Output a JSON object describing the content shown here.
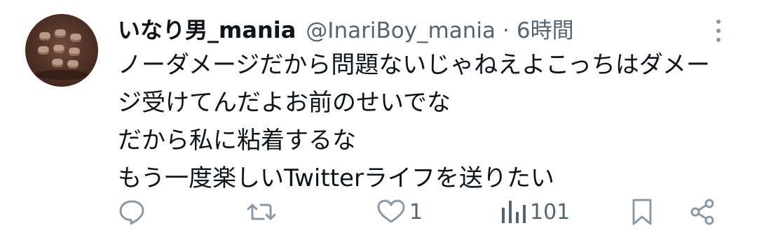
{
  "author": {
    "display_name": "いなり男_mania",
    "handle": "@InariBoy_mania",
    "separator": "·",
    "time": "6時間"
  },
  "tweet": {
    "lines": [
      "ノーダメージだから問題ないじゃねえよこっちはダメー",
      "ジ受けてんだよお前のせいでな",
      "だから私に粘着するな",
      "もう一度楽しいTwitterライフを送りたい"
    ]
  },
  "actions": {
    "reply": {
      "icon": "reply-icon",
      "count": ""
    },
    "retweet": {
      "icon": "retweet-icon",
      "count": ""
    },
    "like": {
      "icon": "heart-icon",
      "count": "1"
    },
    "views": {
      "icon": "views-icon",
      "count": "101"
    },
    "bookmark": {
      "icon": "bookmark-icon"
    },
    "share": {
      "icon": "share-icon"
    }
  },
  "colors": {
    "text": "#0f1419",
    "secondary": "#536471",
    "icon": "#8b98a5"
  }
}
